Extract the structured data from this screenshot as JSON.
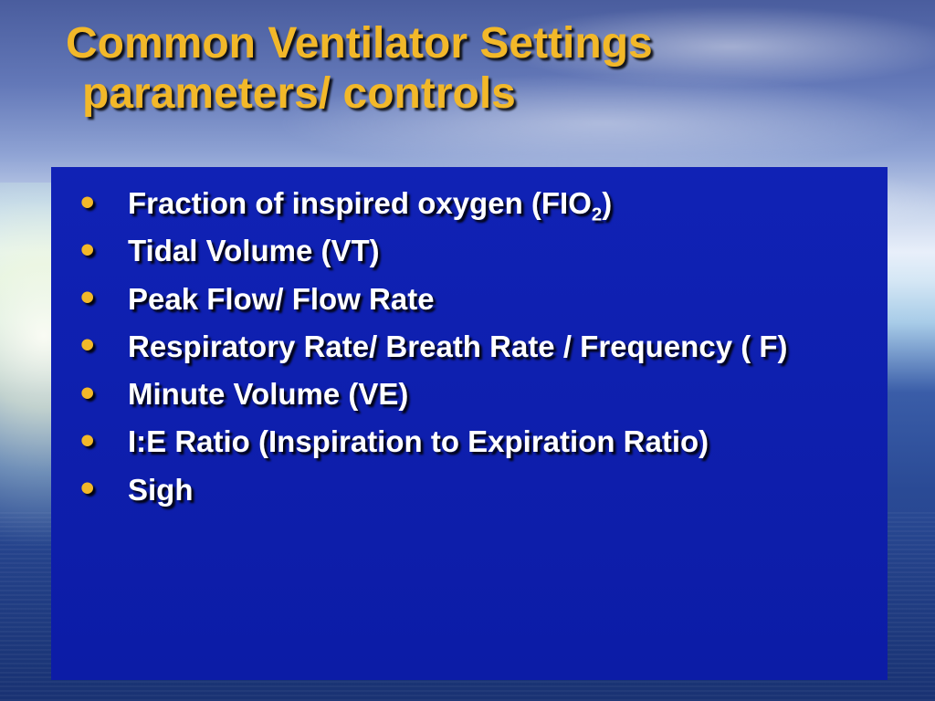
{
  "title": {
    "line1": "Common Ventilator Settings",
    "line2": "parameters/ controls"
  },
  "bullets": [
    {
      "pre": "Fraction of inspired oxygen (FIO",
      "sub": "2",
      "post": ")"
    },
    {
      "pre": "Tidal Volume (VT)",
      "sub": "",
      "post": ""
    },
    {
      "pre": "Peak Flow/ Flow Rate",
      "sub": "",
      "post": ""
    },
    {
      "pre": "Respiratory Rate/ Breath Rate / Frequency ( F)",
      "sub": "",
      "post": ""
    },
    {
      "pre": "Minute Volume  (VE)",
      "sub": "",
      "post": ""
    },
    {
      "pre": "I:E  Ratio  (Inspiration to Expiration Ratio)",
      "sub": "",
      "post": ""
    },
    {
      "pre": "Sigh",
      "sub": "",
      "post": ""
    }
  ],
  "colors": {
    "accent": "#f2b829",
    "panel": "#1020b0",
    "text": "#ffffff"
  }
}
